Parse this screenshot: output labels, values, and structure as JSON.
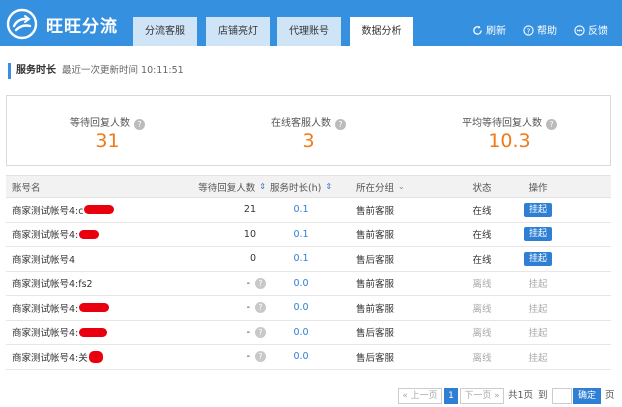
{
  "header": {
    "brand": "旺旺分流",
    "tabs": [
      {
        "label": "分流客服",
        "active": false
      },
      {
        "label": "店铺亮灯",
        "active": false
      },
      {
        "label": "代理账号",
        "active": false
      },
      {
        "label": "数据分析",
        "active": true
      }
    ],
    "refresh_label": "刷新",
    "help_label": "帮助",
    "feedback_label": "反馈"
  },
  "section": {
    "title": "服务时长",
    "last_update": "最近一次更新时间 10:11:51"
  },
  "stats": [
    {
      "label": "等待回复人数",
      "value": "31"
    },
    {
      "label": "在线客服人数",
      "value": "3"
    },
    {
      "label": "平均等待回复人数",
      "value": "10.3"
    }
  ],
  "table": {
    "headers": {
      "name": "账号名",
      "wait": "等待回复人数",
      "duration": "服务时长(h)",
      "group": "所在分组",
      "status": "状态",
      "action": "操作"
    },
    "rows": [
      {
        "name": "商家测试帐号4:c",
        "wait": "21",
        "duration": "0.1",
        "group": "售前客服",
        "status": "在线",
        "action": "挂起"
      },
      {
        "name": "商家测试帐号4:",
        "wait": "10",
        "duration": "0.1",
        "group": "售前客服",
        "status": "在线",
        "action": "挂起"
      },
      {
        "name": "商家测试帐号4",
        "wait": "0",
        "duration": "0.1",
        "group": "售后客服",
        "status": "在线",
        "action": "挂起"
      },
      {
        "name": "商家测试帐号4:fs2",
        "wait": "-",
        "duration": "0.0",
        "group": "售前客服",
        "status": "离线",
        "action": "挂起"
      },
      {
        "name": "商家测试帐号4:",
        "wait": "-",
        "duration": "0.0",
        "group": "售前客服",
        "status": "离线",
        "action": "挂起"
      },
      {
        "name": "商家测试帐号4:",
        "wait": "-",
        "duration": "0.0",
        "group": "售后客服",
        "status": "离线",
        "action": "挂起"
      },
      {
        "name": "商家测试帐号4:关",
        "wait": "-",
        "duration": "0.0",
        "group": "售后客服",
        "status": "离线",
        "action": "挂起"
      }
    ]
  },
  "pager": {
    "prev": "« 上一页",
    "current": "1",
    "next": "下一页 »",
    "total": "共1页",
    "goto": "到",
    "confirm": "确定",
    "page_unit": "页"
  },
  "colors": {
    "brand_blue": "#3590df",
    "accent_orange": "#f07a1a",
    "redaction_red": "#e8000f"
  }
}
